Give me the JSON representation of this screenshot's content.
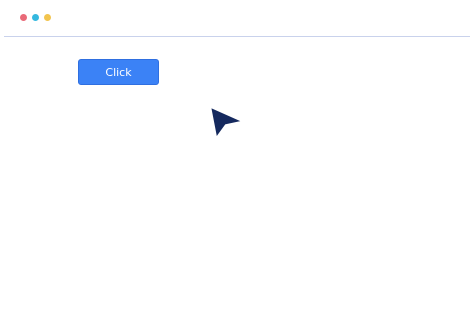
{
  "window": {
    "controls": [
      {
        "name": "close",
        "color": "#e96a78"
      },
      {
        "name": "minimize",
        "color": "#35b8df"
      },
      {
        "name": "maximize",
        "color": "#f2c44e"
      }
    ]
  },
  "main": {
    "button": {
      "label": "Click",
      "color": "#3b82f6"
    },
    "pointer": {
      "icon": "mouse-pointer-icon",
      "color": "#15295e"
    }
  }
}
